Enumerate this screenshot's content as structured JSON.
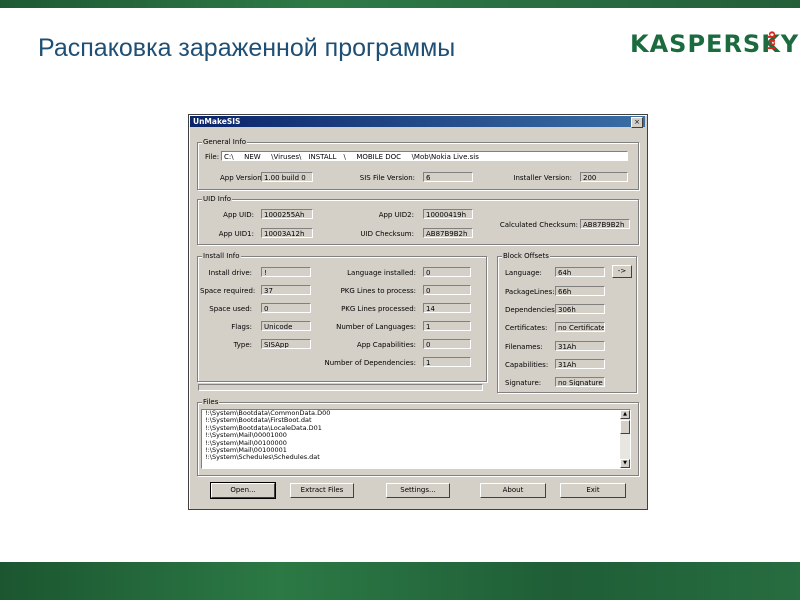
{
  "slide": {
    "title": "Распаковка зараженной программы",
    "logo": "KASPERSKY",
    "logo_lab": "lab"
  },
  "window": {
    "title": "UnMakeSIS",
    "close": "×"
  },
  "general": {
    "legend": "General Info",
    "file_label": "File:",
    "file_value": "C:\\___NEW___\\Viruses\\__INSTALL__\\___MOBILE DOC___\\Mob\\Nokia Live.sis",
    "app_version_label": "App Version:",
    "app_version": "1.00 build 0",
    "sis_version_label": "SIS File Version:",
    "sis_version": "6",
    "installer_version_label": "Installer Version:",
    "installer_version": "200"
  },
  "uid": {
    "legend": "UID Info",
    "app_uid_label": "App UID:",
    "app_uid": "1000255Ah",
    "app_uid1_label": "App UID1:",
    "app_uid1": "10003A12h",
    "app_uid2_label": "App UID2:",
    "app_uid2": "10000419h",
    "uid_checksum_label": "UID Checksum:",
    "uid_checksum": "AB87B9B2h",
    "calc_checksum_label": "Calculated Checksum:",
    "calc_checksum": "AB87B9B2h"
  },
  "install": {
    "legend": "Install Info",
    "left": [
      {
        "label": "Install drive:",
        "value": "!"
      },
      {
        "label": "Space required:",
        "value": "37"
      },
      {
        "label": "Space used:",
        "value": "0"
      },
      {
        "label": "Flags:",
        "value": "Unicode"
      },
      {
        "label": "Type:",
        "value": "SISApp"
      }
    ],
    "right": [
      {
        "label": "Language installed:",
        "value": "0"
      },
      {
        "label": "PKG Lines to process:",
        "value": "0"
      },
      {
        "label": "PKG Lines processed:",
        "value": "14"
      },
      {
        "label": "Number of Languages:",
        "value": "1"
      },
      {
        "label": "App Capabilities:",
        "value": "0"
      },
      {
        "label": "Number of Dependencies:",
        "value": "1"
      }
    ]
  },
  "block": {
    "legend": "Block Offsets",
    "items": [
      {
        "label": "Language:",
        "value": "64h"
      },
      {
        "label": "PackageLines:",
        "value": "66h"
      },
      {
        "label": "Dependencies:",
        "value": "306h"
      },
      {
        "label": "Certificates:",
        "value": "no Certificate"
      },
      {
        "label": "Filenames:",
        "value": "31Ah"
      },
      {
        "label": "Capabilities:",
        "value": "31Ah"
      },
      {
        "label": "Signature:",
        "value": "no Signature"
      }
    ],
    "arrow": "->"
  },
  "files": {
    "legend": "Files",
    "rows": [
      "!:\\System\\Bootdata\\CommonData.D00",
      "!:\\System\\Bootdata\\FirstBoot.dat",
      "!:\\System\\Bootdata\\LocaleData.D01",
      "!:\\System\\Mail\\00001000",
      "!:\\System\\Mail\\00100000",
      "!:\\System\\Mail\\00100001",
      "!:\\System\\Schedules\\Schedules.dat"
    ]
  },
  "buttons": {
    "open": "Open...",
    "extract": "Extract Files",
    "settings": "Settings...",
    "about": "About",
    "exit": "Exit"
  }
}
